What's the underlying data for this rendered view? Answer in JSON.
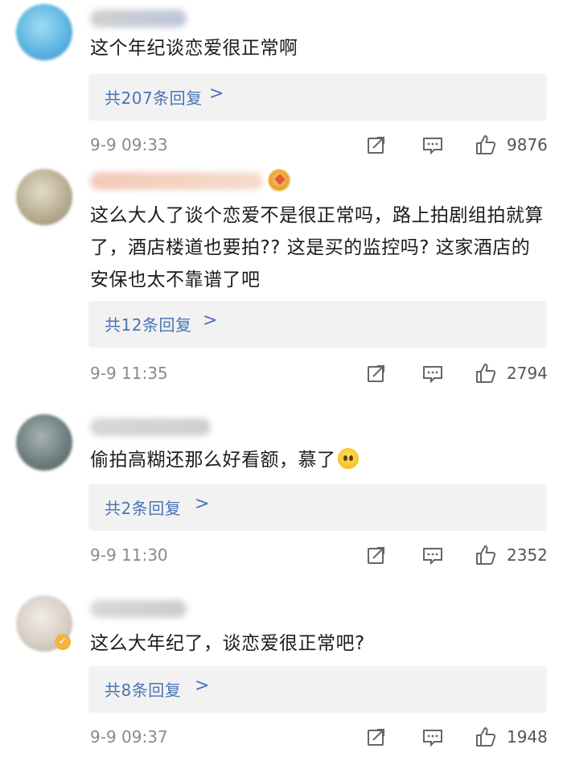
{
  "comments": [
    {
      "text": "这个年纪谈恋爱很正常啊",
      "replies": "共207条回复",
      "timestamp": "9-9 09:33",
      "likes": "9876",
      "avatar_color": "#5fb6e3"
    },
    {
      "text": "这么大人了谈个恋爱不是很正常吗，路上拍剧组拍就算了，酒店楼道也要拍?? 这是买的监控吗? 这家酒店的安保也太不靠谱了吧",
      "replies": "共12条回复",
      "timestamp": "9-9 11:35",
      "likes": "2794",
      "avatar_color": "#b9ae92"
    },
    {
      "text": "偷拍高糊还那么好看额，慕了",
      "replies": "共2条回复",
      "timestamp": "9-9 11:30",
      "likes": "2352",
      "avatar_color": "#6f7f80"
    },
    {
      "text": "这么大年纪了，谈恋爱很正常吧?",
      "replies": "共8条回复",
      "timestamp": "9-9 09:37",
      "likes": "1948",
      "avatar_color": "#d8cfc6"
    }
  ],
  "reply_chevron": ">",
  "colors": {
    "link": "#4a74b6",
    "meta": "#8a8a8a",
    "reply_bg": "#f2f2f2"
  },
  "icons": {
    "share": "share-icon",
    "comment": "comment-icon",
    "like": "thumbs-up-icon"
  }
}
